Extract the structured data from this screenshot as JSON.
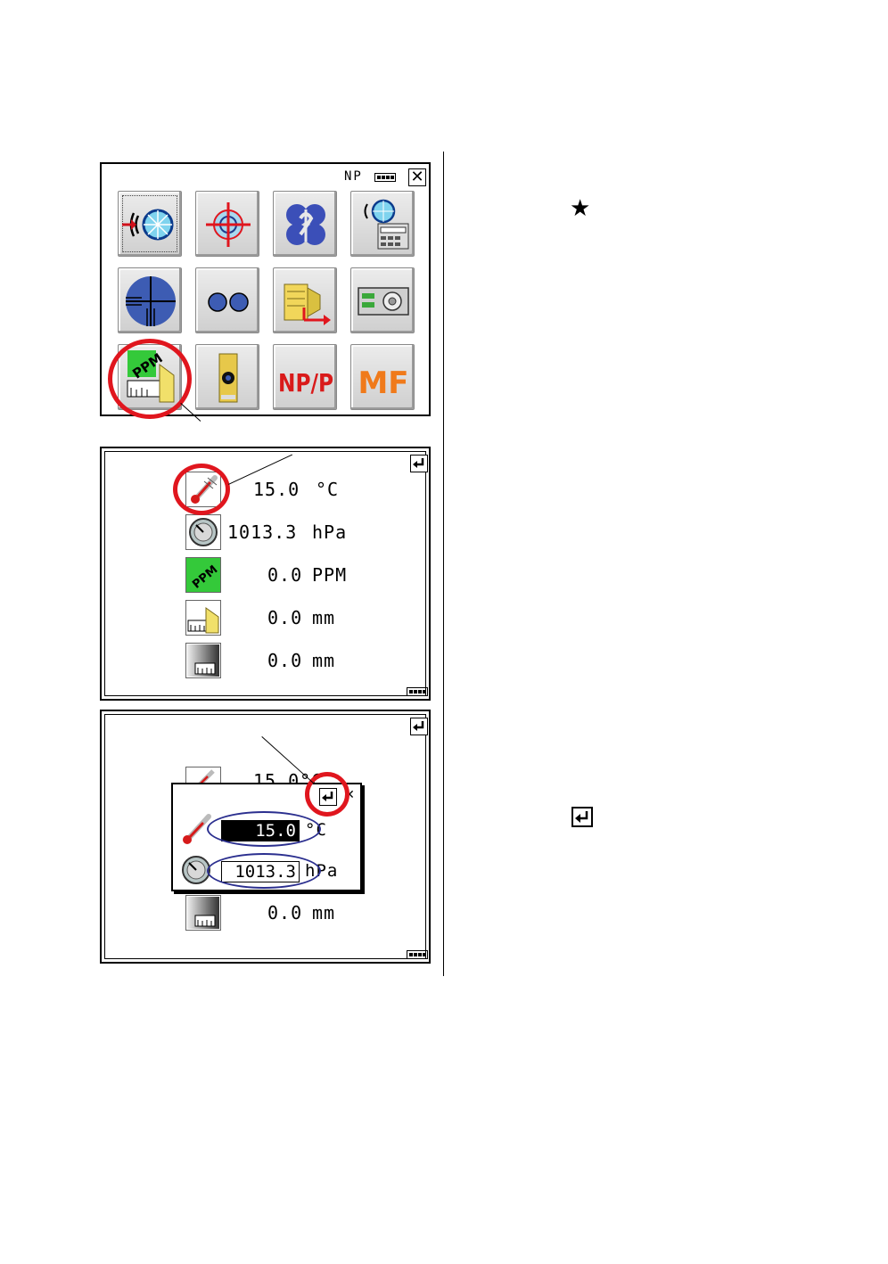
{
  "colors": {
    "accent_circle": "#e0161e",
    "field_ellipse": "#2b2f8f",
    "ppm_green": "#34c93a"
  },
  "star_symbol": "★",
  "menu_screen": {
    "status": {
      "target": "NP",
      "battery_icon": "battery-icon",
      "close_label": "✕"
    },
    "tiles": [
      {
        "name": "measure-edm",
        "icon": "edm-target-icon"
      },
      {
        "name": "sight-target",
        "icon": "crosshair-target-icon"
      },
      {
        "name": "program",
        "icon": "program-logo-icon"
      },
      {
        "name": "edm-config",
        "icon": "edm-keypad-icon"
      },
      {
        "name": "reticle",
        "icon": "reticle-icon"
      },
      {
        "name": "tilt",
        "icon": "dual-dots-icon"
      },
      {
        "name": "data-output",
        "icon": "data-output-icon"
      },
      {
        "name": "card-memory",
        "icon": "memory-card-icon"
      },
      {
        "name": "ppm-correction",
        "icon": "ppm-prism-icon"
      },
      {
        "name": "level",
        "icon": "level-vial-icon"
      },
      {
        "name": "np-p-toggle",
        "icon": "np-p-icon",
        "label": "NP/P"
      },
      {
        "name": "manual-focus",
        "icon": "mf-icon",
        "label": "MF"
      }
    ]
  },
  "ppm_screen": {
    "rows": [
      {
        "icon": "thermometer-icon",
        "value": "15.0",
        "unit": "°C"
      },
      {
        "icon": "barometer-icon",
        "value": "1013.3",
        "unit": "hPa"
      },
      {
        "icon": "ppm-icon",
        "value": "0.0",
        "unit": "PPM",
        "badge": "PPM"
      },
      {
        "icon": "prism-constant-icon",
        "value": "0.0",
        "unit": "mm"
      },
      {
        "icon": "np-constant-icon",
        "value": "0.0",
        "unit": "mm"
      }
    ]
  },
  "edit_screen": {
    "background_row_value": "15.0°C",
    "dialog": {
      "temp_value": "15.0",
      "temp_unit": "°C",
      "press_value": "1013.3",
      "press_unit": "hPa"
    },
    "bottom_row": {
      "value": "0.0",
      "unit": "mm"
    }
  }
}
